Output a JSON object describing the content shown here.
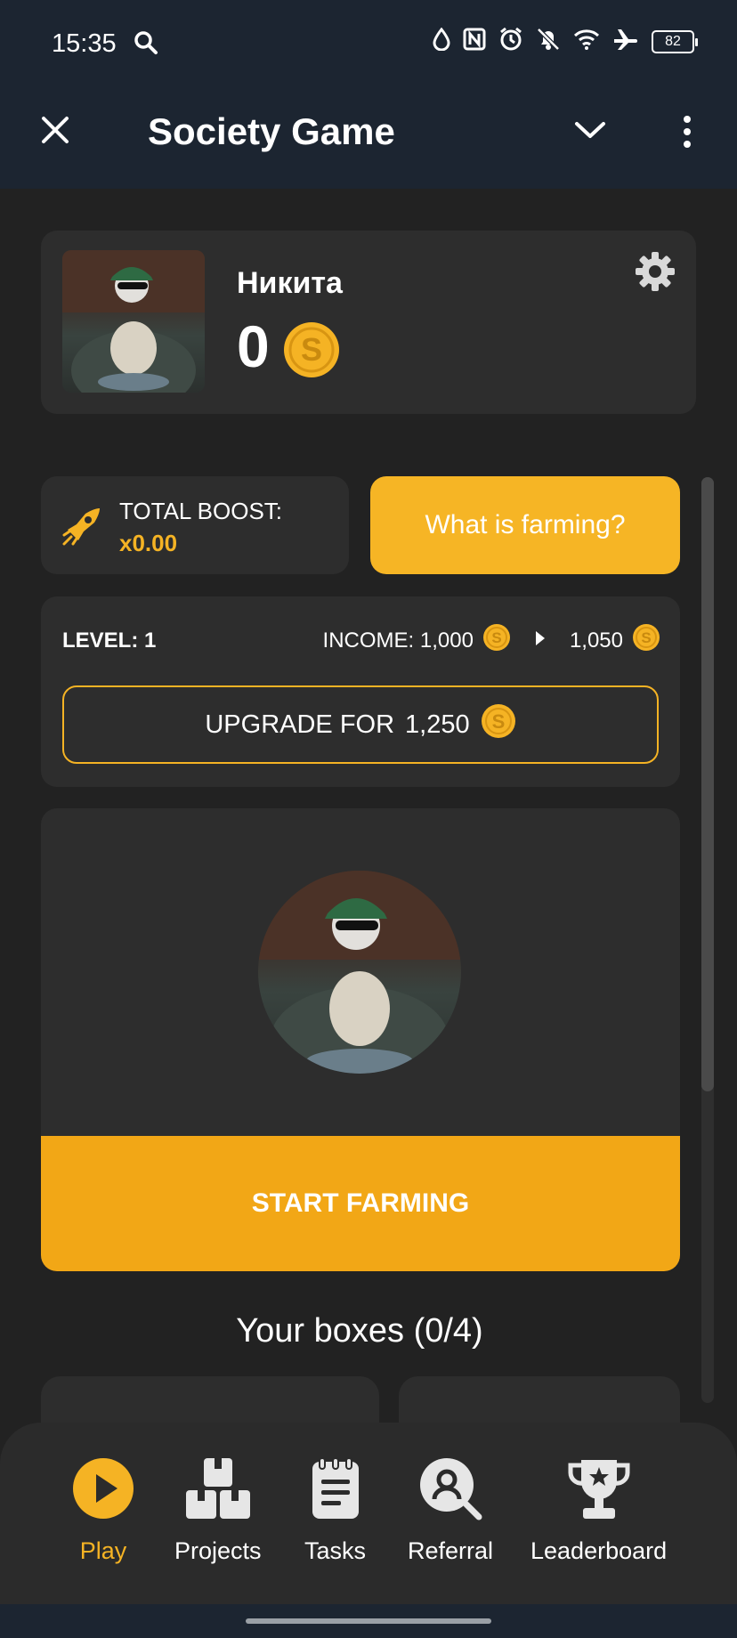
{
  "status_bar": {
    "time": "15:35",
    "battery": "82",
    "icons": [
      "search-icon",
      "drop-icon",
      "nfc-icon",
      "alarm-icon",
      "bell-off-icon",
      "wifi-icon",
      "airplane-icon",
      "battery-icon"
    ]
  },
  "header": {
    "title": "Society Game"
  },
  "profile": {
    "name": "Никита",
    "balance": "0"
  },
  "boost": {
    "label": "TOTAL BOOST:",
    "value": "x0.00"
  },
  "farming_info_button": "What is farming?",
  "level": {
    "label": "LEVEL: 1",
    "income_label": "INCOME: 1,000",
    "income_next": "1,050",
    "upgrade_label": "UPGRADE FOR",
    "upgrade_cost": "1,250"
  },
  "farming": {
    "start_label": "START FARMING"
  },
  "boxes": {
    "title": "Your boxes (0/4)"
  },
  "bottom_nav": {
    "items": [
      {
        "label": "Play",
        "icon": "play-icon",
        "active": true
      },
      {
        "label": "Projects",
        "icon": "boxes-icon",
        "active": false
      },
      {
        "label": "Tasks",
        "icon": "clipboard-icon",
        "active": false
      },
      {
        "label": "Referral",
        "icon": "referral-icon",
        "active": false
      },
      {
        "label": "Leaderboard",
        "icon": "trophy-icon",
        "active": false
      }
    ]
  },
  "colors": {
    "accent": "#f5b324",
    "background": "#222222",
    "card": "#2d2d2d",
    "header": "#1c2531"
  }
}
